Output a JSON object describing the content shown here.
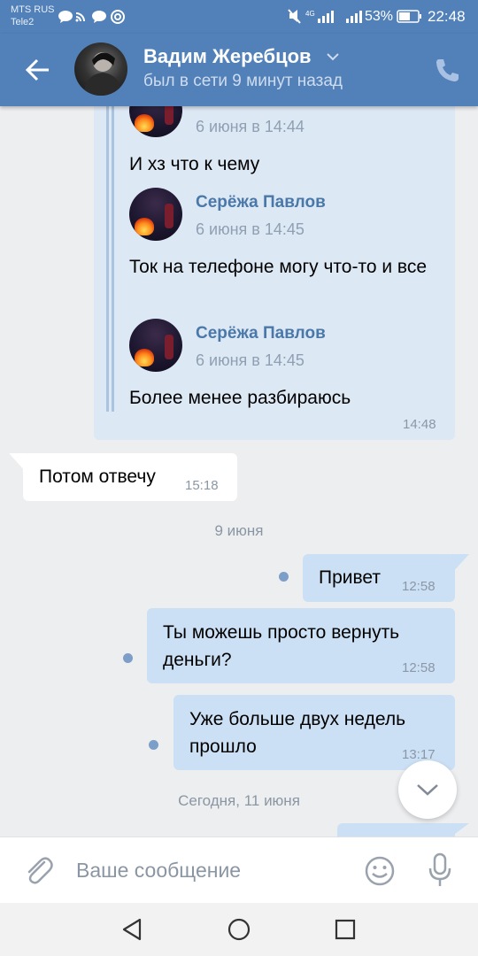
{
  "status_bar": {
    "carrier1": "MTS RUS",
    "carrier2": "Tele2",
    "network": "4G",
    "battery": "53%",
    "time": "22:48"
  },
  "header": {
    "name": "Вадим Жеребцов",
    "status": "был в сети 9 минут назад",
    "back_icon": "arrow-left-icon",
    "dropdown_icon": "chevron-down-icon",
    "call_icon": "phone-icon"
  },
  "forwarded": {
    "top_date": "6 июня в 14:44",
    "text1": "И хз что к чему",
    "item2": {
      "sender": "Серёжа Павлов",
      "date": "6 июня в 14:45",
      "text": "Ток на телефоне могу что-то и все"
    },
    "item3": {
      "sender": "Серёжа Павлов",
      "date": "6 июня в 14:45",
      "text": "Более менее разбираюсь"
    },
    "time": "14:48"
  },
  "messages": [
    {
      "direction": "in",
      "text": "Потом отвечу",
      "time": "15:18"
    },
    {
      "direction": "separator",
      "text": "9 июня"
    },
    {
      "direction": "out",
      "text": "Привет",
      "time": "12:58"
    },
    {
      "direction": "out",
      "text": "Ты можешь просто вернуть деньги?",
      "time": "12:58"
    },
    {
      "direction": "out",
      "text": "Уже больше двух недель прошло",
      "time": "13:17"
    },
    {
      "direction": "separator",
      "text": "Сегодня, 11 июня"
    }
  ],
  "composer": {
    "placeholder": "Ваше сообщение",
    "attach_icon": "paperclip-icon",
    "emoji_icon": "smile-icon",
    "mic_icon": "microphone-icon"
  },
  "scroll_down_icon": "chevron-down-icon",
  "nav": {
    "back": "triangle-back-icon",
    "home": "circle-home-icon",
    "recents": "square-recents-icon"
  },
  "colors": {
    "brand": "#5181b8",
    "outgoing": "#cce0f5",
    "incoming": "#ffffff",
    "background": "#edeef0"
  }
}
